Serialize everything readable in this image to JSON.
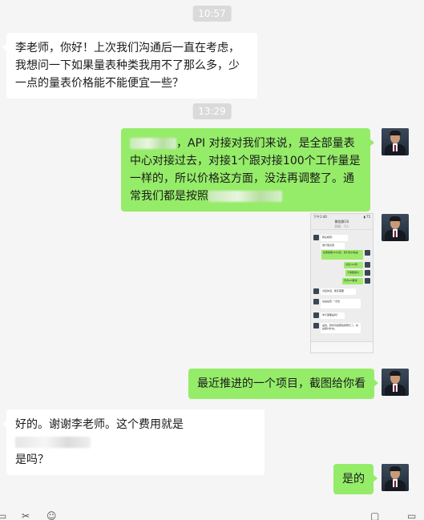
{
  "messages": {
    "time1": "10:57",
    "msg1": "李老师，你好！上次我们沟通后一直在考虑，我想问一下如果量表种类我用不了那么多，少一点的量表价格能不能便宜一些？",
    "time2": "13:29",
    "msg2_a": "，API 对接对我们来说，是全部量表中心对接过去，对接1个跟对接100个工作量是一样的，所以价格这方面，没法再调整了。通常我们都是按照",
    "msg3": "最近推进的一个项目，截图给你看",
    "msg4_a": "好的。谢谢李老师。这个费用就是",
    "msg4_b": "是吗？",
    "msg5": "是的"
  },
  "screenshot": {
    "status_left": "下午1:40 ",
    "status_right": "▮ 75",
    "header_title": "微信群(3)",
    "header_sub": "群聊 · 3人",
    "lines": [
      "群主昵称：",
      "量行量表题",
      "如果需要API对接，我们的价格是",
      "对接100项",
      "不需要报价",
      "符合API要求",
      "对接的话，那还需要",
      "这是是否 一次性",
      "你不需要是吗？",
      "是的，软件包括那些我帮忙了。将是报价补充。"
    ]
  },
  "toolbar": {
    "emoji_icon": "☺",
    "scissors_icon": "✂",
    "folder_icon": "▭",
    "chat_icon": "▢"
  }
}
